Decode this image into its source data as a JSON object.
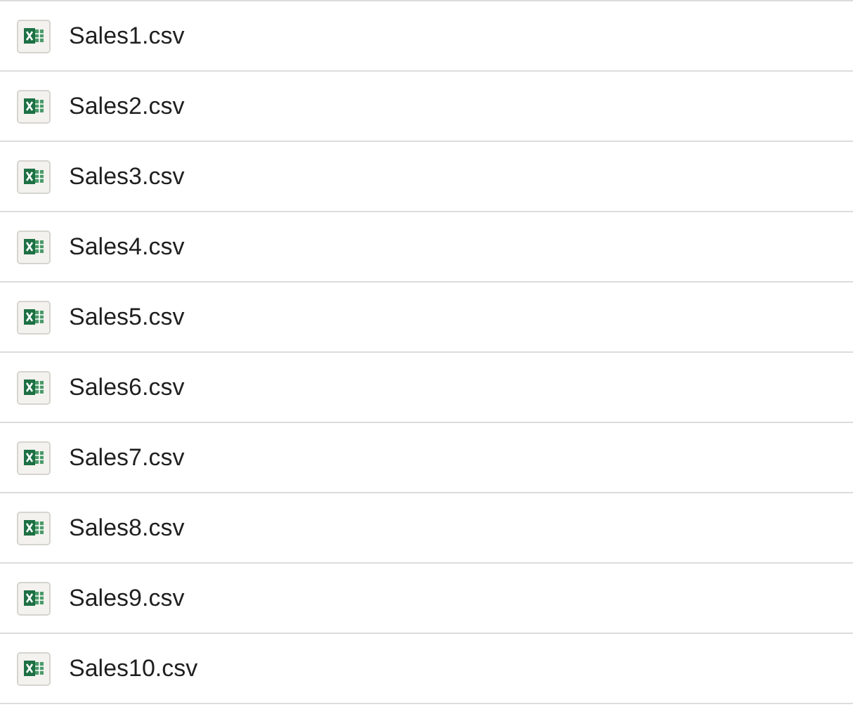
{
  "files": [
    {
      "name": "Sales1.csv"
    },
    {
      "name": "Sales2.csv"
    },
    {
      "name": "Sales3.csv"
    },
    {
      "name": "Sales4.csv"
    },
    {
      "name": "Sales5.csv"
    },
    {
      "name": "Sales6.csv"
    },
    {
      "name": "Sales7.csv"
    },
    {
      "name": "Sales8.csv"
    },
    {
      "name": "Sales9.csv"
    },
    {
      "name": "Sales10.csv"
    }
  ]
}
